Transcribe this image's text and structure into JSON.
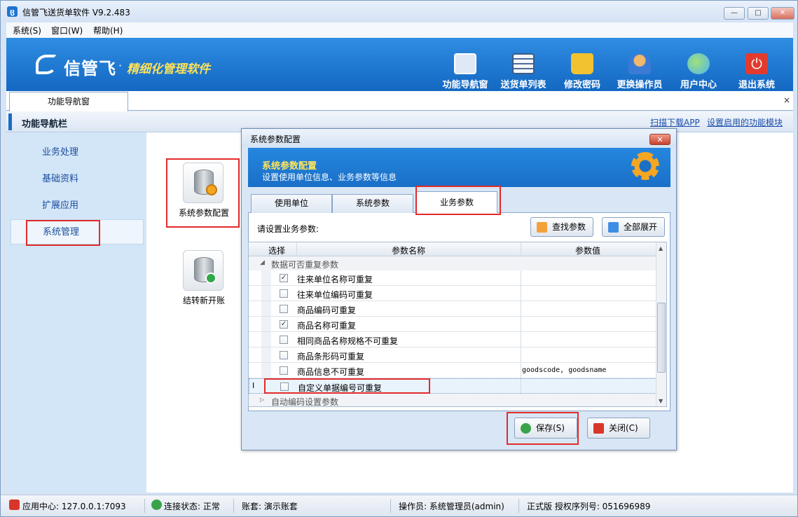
{
  "window": {
    "title": "信管飞送货单软件 V9.2.483",
    "icon_name": "app-logo-icon",
    "controls": [
      "minimize",
      "maximize",
      "close"
    ]
  },
  "menu": [
    {
      "label": "系统(S)"
    },
    {
      "label": "窗口(W)"
    },
    {
      "label": "帮助(H)"
    }
  ],
  "banner": {
    "brand": "信管飞",
    "dot": "·",
    "slogan": "精细化管理软件",
    "buttons": [
      {
        "label": "功能导航窗",
        "icon": "monitor-icon",
        "color": "#dfe9f6"
      },
      {
        "label": "送货单列表",
        "icon": "list-icon",
        "color": "#f4f6f9"
      },
      {
        "label": "修改密码",
        "icon": "lock-icon",
        "color": "#f2c230"
      },
      {
        "label": "更换操作员",
        "icon": "user-icon",
        "color": "#f1b96b"
      },
      {
        "label": "用户中心",
        "icon": "globe-icon",
        "color": "#4fb3f0"
      },
      {
        "label": "退出系统",
        "icon": "power-icon",
        "color": "#e23b2e"
      }
    ]
  },
  "tabs": {
    "main_tab": "功能导航窗",
    "close_glyph": "×"
  },
  "nav_header": {
    "title": "功能导航栏",
    "links": [
      "扫描下载APP",
      "设置启用的功能模块"
    ]
  },
  "sidebar": {
    "items": [
      {
        "label": "业务处理"
      },
      {
        "label": "基础资料"
      },
      {
        "label": "扩展应用"
      },
      {
        "label": "系统管理",
        "selected": true
      }
    ]
  },
  "modules": [
    {
      "label": "系统参数配置",
      "icon": "database-settings-icon"
    },
    {
      "label": "结转新开账",
      "icon": "database-refresh-icon"
    }
  ],
  "dialog": {
    "title": "系统参数配置",
    "close_glyph": "✕",
    "banner_title": "系统参数配置",
    "banner_subtitle": "设置使用单位信息、业务参数等信息",
    "tabs": [
      "使用单位",
      "系统参数",
      "业务参数"
    ],
    "active_tab": "业务参数",
    "prompt": "请设置业务参数:",
    "find_button": "查找参数",
    "expand_button": "全部展开",
    "columns": [
      "选择",
      "参数名称",
      "参数值"
    ],
    "groups": [
      {
        "name": "数据可否重复参数",
        "expanded": true,
        "rows": [
          {
            "name": "往来单位名称可重复",
            "checked": true,
            "value": ""
          },
          {
            "name": "往来单位编码可重复",
            "checked": false,
            "value": ""
          },
          {
            "name": "商品编码可重复",
            "checked": false,
            "value": ""
          },
          {
            "name": "商品名称可重复",
            "checked": true,
            "value": ""
          },
          {
            "name": "相同商品名称规格不可重复",
            "checked": false,
            "value": ""
          },
          {
            "name": "商品条形码可重复",
            "checked": false,
            "value": ""
          },
          {
            "name": "商品信息不可重复",
            "checked": false,
            "value": "goodscode, goodsname"
          },
          {
            "name": "自定义单据编号可重复",
            "checked": false,
            "value": "",
            "current": true
          }
        ]
      },
      {
        "name": "自动编码设置参数",
        "expanded": false,
        "rows": []
      }
    ],
    "row_cursor_glyph": "I",
    "check_glyph": "✓",
    "save_button": "保存(S)",
    "close_button": "关闭(C)"
  },
  "statusbar": {
    "app_center": "应用中心: 127.0.0.1:7093",
    "connection": "连接状态: 正常",
    "account": "账套: 演示账套",
    "operator": "操作员: 系统管理员(admin)",
    "license": "正式版 授权序列号: 051696989"
  },
  "colors": {
    "banner": "#1f7bd6",
    "highlight_box": "#e32b2b",
    "slogan": "#fce25a",
    "dialog_banner_title": "#ffe45a"
  }
}
